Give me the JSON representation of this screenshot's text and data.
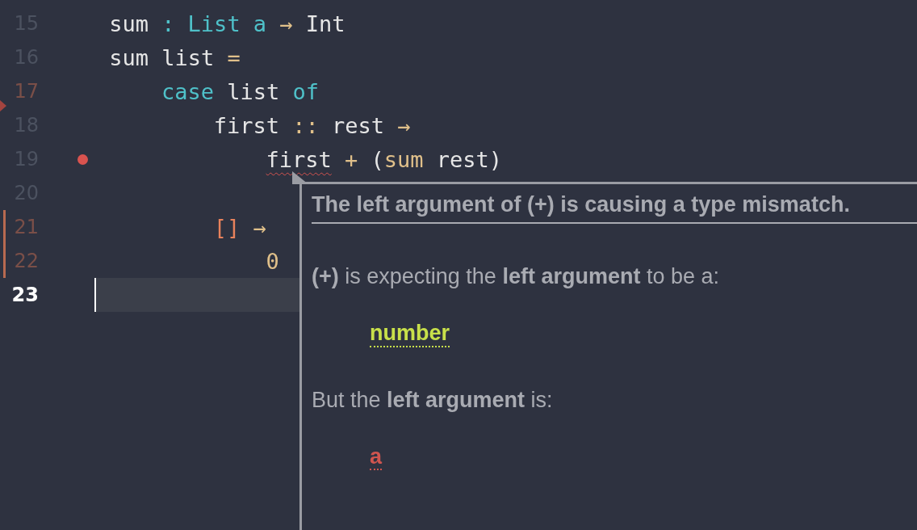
{
  "lines": [
    {
      "number": "15",
      "modified": false,
      "deleted": false,
      "error": false,
      "current": false,
      "tokens": [
        {
          "text": "sum",
          "kind": "plain"
        },
        {
          "text": ":",
          "kind": "type"
        },
        {
          "text": "List",
          "kind": "type"
        },
        {
          "text": "a",
          "kind": "type"
        },
        {
          "text": "→",
          "kind": "operator"
        },
        {
          "text": "Int",
          "kind": "plain"
        }
      ]
    },
    {
      "number": "16",
      "modified": false,
      "deleted": false,
      "error": false,
      "current": false,
      "tokens": [
        {
          "text": "sum",
          "kind": "plain"
        },
        {
          "text": "list",
          "kind": "plain"
        },
        {
          "text": "=",
          "kind": "operator"
        }
      ],
      "children": [
        {
          "number": "17",
          "modified": false,
          "deleted": true,
          "error": false,
          "current": false,
          "tokens": [
            {
              "text": "case",
              "kind": "keyword"
            },
            {
              "text": "list",
              "kind": "plain"
            },
            {
              "text": "of",
              "kind": "keyword"
            }
          ],
          "children": [
            {
              "number": "18",
              "modified": false,
              "deleted": false,
              "error": false,
              "current": false,
              "tokens": [
                {
                  "text": "first",
                  "kind": "plain"
                },
                {
                  "text": "::",
                  "kind": "operator"
                },
                {
                  "text": "rest",
                  "kind": "plain"
                },
                {
                  "text": "→",
                  "kind": "operator"
                }
              ],
              "children": [
                {
                  "number": "19",
                  "modified": false,
                  "deleted": false,
                  "error": true,
                  "current": false,
                  "tokens": [
                    {
                      "text": "first",
                      "kind": "plain",
                      "squiggle": true
                    },
                    {
                      "text": "+",
                      "kind": "operator"
                    },
                    {
                      "text": "(",
                      "kind": "plain"
                    },
                    {
                      "text": "sum",
                      "kind": "operator",
                      "attached": true
                    },
                    {
                      "text": "rest",
                      "kind": "plain"
                    },
                    {
                      "text": ")",
                      "kind": "plain",
                      "attached": true
                    }
                  ]
                },
                {
                  "number": "20",
                  "modified": false,
                  "deleted": false,
                  "error": false,
                  "current": false
                }
              ]
            },
            {
              "number": "21",
              "modified": true,
              "deleted": false,
              "error": false,
              "current": false,
              "tokens": [
                {
                  "text": "[]",
                  "kind": "bracket"
                },
                {
                  "text": "→",
                  "kind": "operator"
                }
              ],
              "children": [
                {
                  "number": "22",
                  "modified": true,
                  "deleted": false,
                  "error": false,
                  "current": false,
                  "tokens": [
                    {
                      "text": "0",
                      "kind": "operator"
                    }
                  ]
                }
              ]
            }
          ]
        }
      ]
    },
    {
      "number": "23",
      "modified": false,
      "deleted": false,
      "error": false,
      "current": true
    }
  ],
  "tooltip": {
    "title": "The left argument of (+) is causing a type mismatch.",
    "expected_text": "**(+)** is expecting the **left argument** to be a:",
    "expected_type": "number",
    "actual_text": "But the **left argument** is:",
    "actual_type": "a"
  }
}
